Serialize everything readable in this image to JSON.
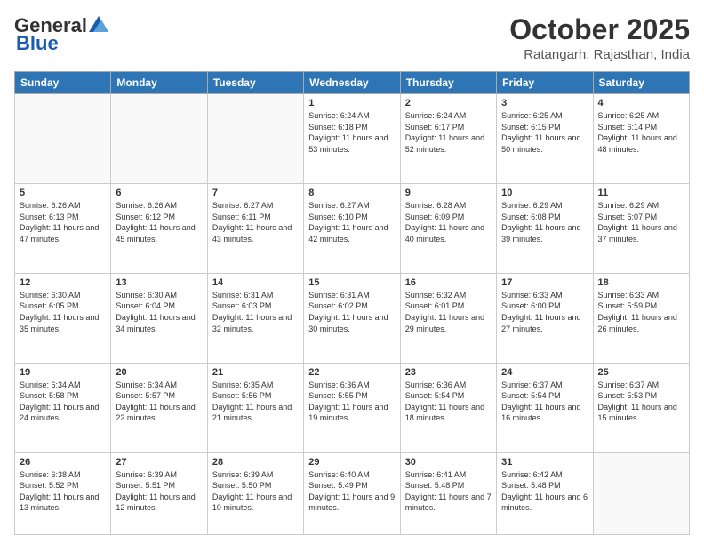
{
  "header": {
    "logo_general": "General",
    "logo_blue": "Blue",
    "month": "October 2025",
    "location": "Ratangarh, Rajasthan, India"
  },
  "weekdays": [
    "Sunday",
    "Monday",
    "Tuesday",
    "Wednesday",
    "Thursday",
    "Friday",
    "Saturday"
  ],
  "weeks": [
    [
      {
        "date": "",
        "info": ""
      },
      {
        "date": "",
        "info": ""
      },
      {
        "date": "",
        "info": ""
      },
      {
        "date": "1",
        "info": "Sunrise: 6:24 AM\nSunset: 6:18 PM\nDaylight: 11 hours and 53 minutes."
      },
      {
        "date": "2",
        "info": "Sunrise: 6:24 AM\nSunset: 6:17 PM\nDaylight: 11 hours and 52 minutes."
      },
      {
        "date": "3",
        "info": "Sunrise: 6:25 AM\nSunset: 6:15 PM\nDaylight: 11 hours and 50 minutes."
      },
      {
        "date": "4",
        "info": "Sunrise: 6:25 AM\nSunset: 6:14 PM\nDaylight: 11 hours and 48 minutes."
      }
    ],
    [
      {
        "date": "5",
        "info": "Sunrise: 6:26 AM\nSunset: 6:13 PM\nDaylight: 11 hours and 47 minutes."
      },
      {
        "date": "6",
        "info": "Sunrise: 6:26 AM\nSunset: 6:12 PM\nDaylight: 11 hours and 45 minutes."
      },
      {
        "date": "7",
        "info": "Sunrise: 6:27 AM\nSunset: 6:11 PM\nDaylight: 11 hours and 43 minutes."
      },
      {
        "date": "8",
        "info": "Sunrise: 6:27 AM\nSunset: 6:10 PM\nDaylight: 11 hours and 42 minutes."
      },
      {
        "date": "9",
        "info": "Sunrise: 6:28 AM\nSunset: 6:09 PM\nDaylight: 11 hours and 40 minutes."
      },
      {
        "date": "10",
        "info": "Sunrise: 6:29 AM\nSunset: 6:08 PM\nDaylight: 11 hours and 39 minutes."
      },
      {
        "date": "11",
        "info": "Sunrise: 6:29 AM\nSunset: 6:07 PM\nDaylight: 11 hours and 37 minutes."
      }
    ],
    [
      {
        "date": "12",
        "info": "Sunrise: 6:30 AM\nSunset: 6:05 PM\nDaylight: 11 hours and 35 minutes."
      },
      {
        "date": "13",
        "info": "Sunrise: 6:30 AM\nSunset: 6:04 PM\nDaylight: 11 hours and 34 minutes."
      },
      {
        "date": "14",
        "info": "Sunrise: 6:31 AM\nSunset: 6:03 PM\nDaylight: 11 hours and 32 minutes."
      },
      {
        "date": "15",
        "info": "Sunrise: 6:31 AM\nSunset: 6:02 PM\nDaylight: 11 hours and 30 minutes."
      },
      {
        "date": "16",
        "info": "Sunrise: 6:32 AM\nSunset: 6:01 PM\nDaylight: 11 hours and 29 minutes."
      },
      {
        "date": "17",
        "info": "Sunrise: 6:33 AM\nSunset: 6:00 PM\nDaylight: 11 hours and 27 minutes."
      },
      {
        "date": "18",
        "info": "Sunrise: 6:33 AM\nSunset: 5:59 PM\nDaylight: 11 hours and 26 minutes."
      }
    ],
    [
      {
        "date": "19",
        "info": "Sunrise: 6:34 AM\nSunset: 5:58 PM\nDaylight: 11 hours and 24 minutes."
      },
      {
        "date": "20",
        "info": "Sunrise: 6:34 AM\nSunset: 5:57 PM\nDaylight: 11 hours and 22 minutes."
      },
      {
        "date": "21",
        "info": "Sunrise: 6:35 AM\nSunset: 5:56 PM\nDaylight: 11 hours and 21 minutes."
      },
      {
        "date": "22",
        "info": "Sunrise: 6:36 AM\nSunset: 5:55 PM\nDaylight: 11 hours and 19 minutes."
      },
      {
        "date": "23",
        "info": "Sunrise: 6:36 AM\nSunset: 5:54 PM\nDaylight: 11 hours and 18 minutes."
      },
      {
        "date": "24",
        "info": "Sunrise: 6:37 AM\nSunset: 5:54 PM\nDaylight: 11 hours and 16 minutes."
      },
      {
        "date": "25",
        "info": "Sunrise: 6:37 AM\nSunset: 5:53 PM\nDaylight: 11 hours and 15 minutes."
      }
    ],
    [
      {
        "date": "26",
        "info": "Sunrise: 6:38 AM\nSunset: 5:52 PM\nDaylight: 11 hours and 13 minutes."
      },
      {
        "date": "27",
        "info": "Sunrise: 6:39 AM\nSunset: 5:51 PM\nDaylight: 11 hours and 12 minutes."
      },
      {
        "date": "28",
        "info": "Sunrise: 6:39 AM\nSunset: 5:50 PM\nDaylight: 11 hours and 10 minutes."
      },
      {
        "date": "29",
        "info": "Sunrise: 6:40 AM\nSunset: 5:49 PM\nDaylight: 11 hours and 9 minutes."
      },
      {
        "date": "30",
        "info": "Sunrise: 6:41 AM\nSunset: 5:48 PM\nDaylight: 11 hours and 7 minutes."
      },
      {
        "date": "31",
        "info": "Sunrise: 6:42 AM\nSunset: 5:48 PM\nDaylight: 11 hours and 6 minutes."
      },
      {
        "date": "",
        "info": ""
      }
    ]
  ]
}
